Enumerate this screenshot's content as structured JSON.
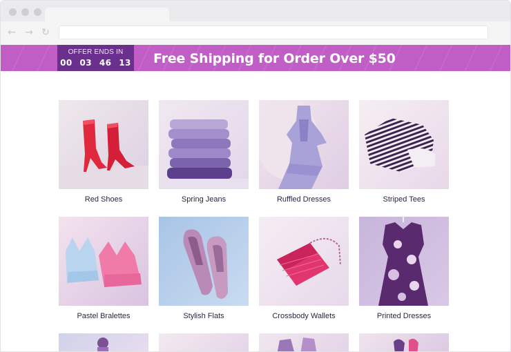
{
  "promo": {
    "timer_label": "OFFER ENDS IN",
    "timer_digits": "00 03 46 13",
    "headline": "Free Shipping for Order Over $50",
    "color": "#c05ec6",
    "timer_color": "#6b2f8e"
  },
  "browser": {
    "back_icon": "arrow-left-icon",
    "forward_icon": "arrow-right-icon",
    "reload_icon": "reload-icon"
  },
  "products": [
    {
      "label": "Red Shoes",
      "icon": "red-ankle-boots"
    },
    {
      "label": "Spring Jeans",
      "icon": "folded-jeans-stack"
    },
    {
      "label": "Ruffled Dresses",
      "icon": "ruffled-dress"
    },
    {
      "label": "Striped Tees",
      "icon": "striped-tee"
    },
    {
      "label": "Pastel Bralettes",
      "icon": "lace-bralettes"
    },
    {
      "label": "Stylish Flats",
      "icon": "pointed-flats"
    },
    {
      "label": "Crossbody Wallets",
      "icon": "crossbody-wallet"
    },
    {
      "label": "Printed Dresses",
      "icon": "printed-dress"
    }
  ],
  "partial_row": [
    {
      "icon": "partial-product-1"
    },
    {
      "icon": "partial-product-2"
    },
    {
      "icon": "partial-product-3"
    },
    {
      "icon": "partial-product-4"
    }
  ]
}
